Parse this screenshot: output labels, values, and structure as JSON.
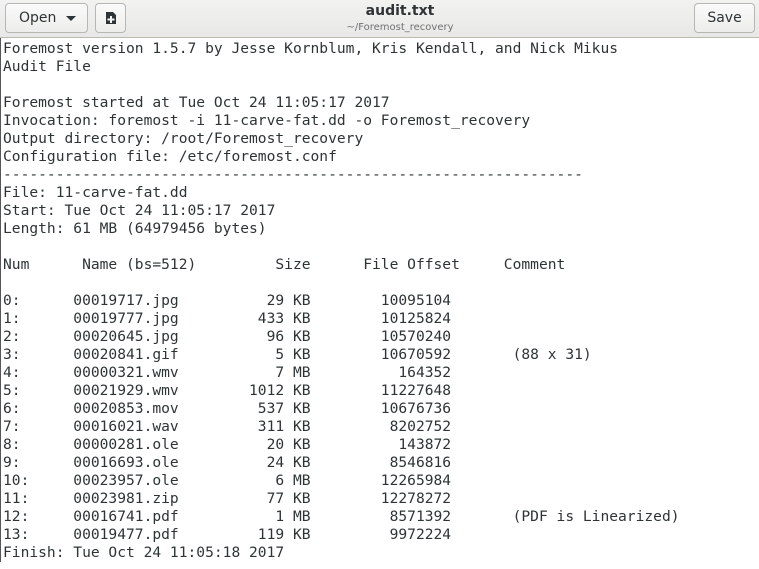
{
  "header": {
    "open_label": "Open",
    "save_label": "Save",
    "title": "audit.txt",
    "subtitle": "~/Foremost_recovery",
    "new_doc_icon": "new-document-icon",
    "open_arrow_icon": "chevron-down-icon"
  },
  "document": {
    "text": "Foremost version 1.5.7 by Jesse Kornblum, Kris Kendall, and Nick Mikus\nAudit File\n\nForemost started at Tue Oct 24 11:05:17 2017\nInvocation: foremost -i 11-carve-fat.dd -o Foremost_recovery\nOutput directory: /root/Foremost_recovery\nConfiguration file: /etc/foremost.conf\n------------------------------------------------------------------\nFile: 11-carve-fat.dd\nStart: Tue Oct 24 11:05:17 2017\nLength: 61 MB (64979456 bytes)\n\nNum      Name (bs=512)         Size      File Offset     Comment\n\n0:      00019717.jpg          29 KB        10095104\n1:      00019777.jpg         433 KB        10125824\n2:      00020645.jpg          96 KB        10570240\n3:      00020841.gif           5 KB        10670592       (88 x 31)\n4:      00000321.wmv           7 MB          164352\n5:      00021929.wmv        1012 KB        11227648\n6:      00020853.mov         537 KB        10676736\n7:      00016021.wav         311 KB         8202752\n8:      00000281.ole          20 KB          143872\n9:      00016693.ole          24 KB         8546816\n10:     00023957.ole           6 MB        12265984\n11:     00023981.zip          77 KB        12278272\n12:     00016741.pdf           1 MB         8571392       (PDF is Linearized)\n13:     00019477.pdf         119 KB         9972224\nFinish: Tue Oct 24 11:05:18 2017"
  }
}
